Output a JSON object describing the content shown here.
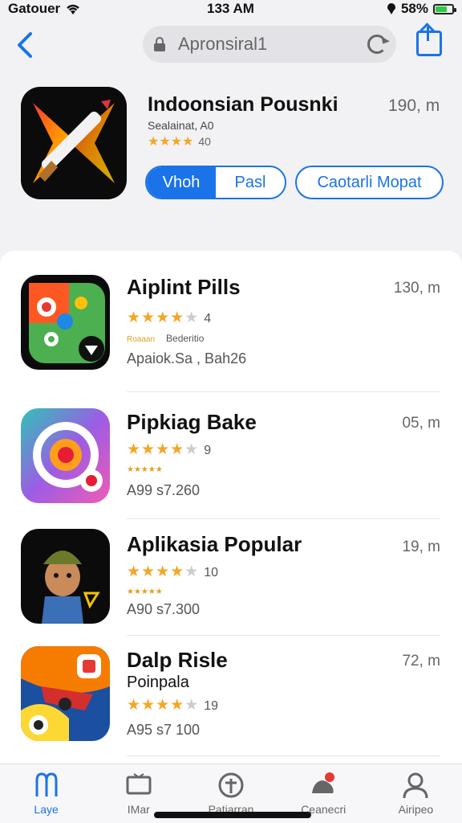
{
  "status_bar": {
    "carrier": "Gatouer",
    "time": "133 AM",
    "battery": "58%"
  },
  "nav": {
    "search_value": "Apronsiral1"
  },
  "featured": {
    "title": "Indoonsian Pousnki",
    "size": "190, m",
    "subtitle": "Sealainat, A0",
    "stars": "★★★★",
    "rating_count": "40",
    "segment_active": "Vhoh",
    "segment_inactive": "Pasl",
    "outline_button": "Caotarli Mopat"
  },
  "apps": [
    {
      "name": "Aiplint Pills",
      "size": "130, m",
      "stars_filled": "★★★★",
      "stars_empty": "★",
      "count": "4",
      "sub_tiny": "Roaaan",
      "sub": "Bederitio",
      "price": "Apaiok.Sa , Bah26"
    },
    {
      "name": "Pipkiag Bake",
      "size": "05, m",
      "stars_filled": "★★★★",
      "stars_empty": "★",
      "count": "9",
      "sub_tiny": "★★★★★",
      "sub": "",
      "price": "A99 s7.260"
    },
    {
      "name": "Aplikasia Popular",
      "size": "19, m",
      "stars_filled": "★★★★",
      "stars_empty": "★",
      "count": "10",
      "sub_tiny": "★★★★★",
      "sub": "",
      "price": "A90 s7.300"
    },
    {
      "name": "Dalp Risle",
      "size": "72, m",
      "stars_filled": "★★★★",
      "stars_empty": "★",
      "count": "19",
      "sub_tiny": "",
      "sub": "Poinpala",
      "price": "A95 s7 100"
    }
  ],
  "tabs": [
    {
      "label": "Laye",
      "icon": "apps-icon"
    },
    {
      "label": "IMar",
      "icon": "tv-icon"
    },
    {
      "label": "Patiarran",
      "icon": "add-circle-icon"
    },
    {
      "label": "Ceanecri",
      "icon": "games-icon"
    },
    {
      "label": "Airipeo",
      "icon": "profile-icon"
    }
  ],
  "colors": {
    "accent": "#1a73e8",
    "star": "#f5a623"
  }
}
